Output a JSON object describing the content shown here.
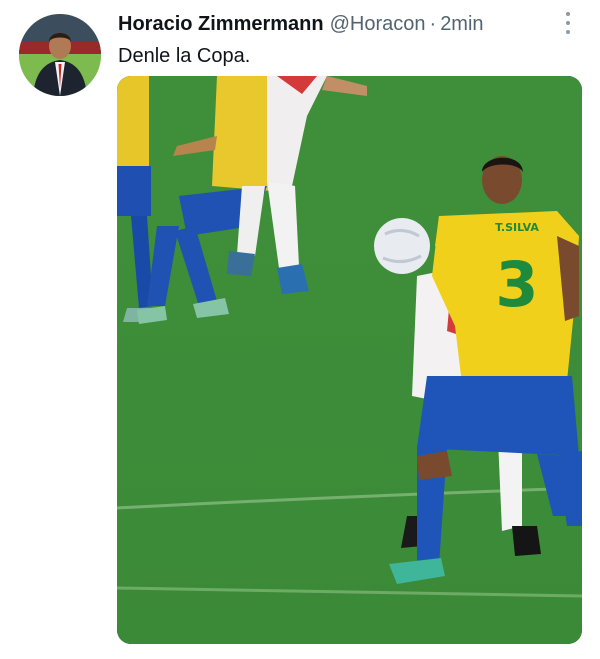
{
  "tweet": {
    "author": {
      "display_name": "Horacio Zimmermann",
      "handle": "@Horacon"
    },
    "separator": "·",
    "time": "2min",
    "text": "Denle la Copa."
  },
  "media": {
    "player_name": "T.SILVA",
    "player_number": "3"
  },
  "icons": {
    "more": "more-vertical-icon"
  }
}
